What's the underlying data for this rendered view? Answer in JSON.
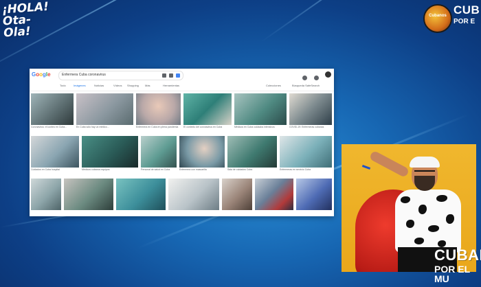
{
  "logos": {
    "left_line1": "¡HOLA!",
    "left_line2": "Ota-Ola!",
    "right_line1": "CUB",
    "right_line2": "POR E",
    "badge_text": "Cubanos"
  },
  "browser": {
    "brand": "Google",
    "search_value": "Enfermera Cuba coronavirus",
    "tabs": [
      "Todo",
      "Imágenes",
      "Noticias",
      "Vídeos",
      "Shopping",
      "Más",
      "Herramientas"
    ],
    "active_tab": "Imágenes",
    "right_controls": [
      "Colecciones",
      "Búsqueda SafeSearch"
    ],
    "rows": [
      {
        "captions": [
          "Coronavirus: el conteo en Cuba...",
          "En Cuba sólo hay un médico...",
          "Enfermera en Cuba en plena pandemia",
          "El contexto del coronavirus en Cuba",
          "Médicos en Cuba cuidados intensivos",
          "COVID-19: Enfermeras cubanas"
        ]
      },
      {
        "captions": [
          "Cuidados en Cuba hospital",
          "Médicos cubanos equipos",
          "Personal de salud en Cuba",
          "Enfermera con mascarilla",
          "Sala de cuidados Cuba",
          "Enfermeras en servicio Cuba"
        ]
      },
      {
        "captions": [
          "",
          "",
          "",
          "",
          "",
          "",
          ""
        ]
      }
    ]
  },
  "overlay": {
    "cubanos_line1": "CUBAN",
    "cubanos_line2": "POR EL MU"
  },
  "colors": {
    "bg_dark": "#0a2c66",
    "bg_light": "#2a8fd6",
    "host_bg": "#f0b72e",
    "chair": "#d0261d"
  }
}
